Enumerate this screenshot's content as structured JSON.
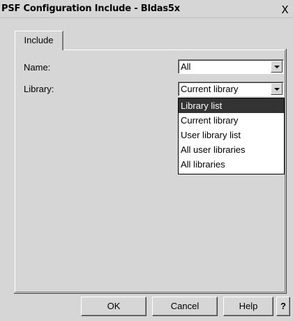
{
  "window": {
    "title": "PSF Configuration Include - Bldas5x",
    "close_glyph": "X"
  },
  "tabs": [
    {
      "label": "Include",
      "selected": true
    }
  ],
  "form": {
    "name_label": "Name:",
    "name_value": "All",
    "library_label": "Library:",
    "library_value": "Current library"
  },
  "library_dropdown": {
    "open": true,
    "options": [
      "Library list",
      "Current library",
      "User library list",
      "All user libraries",
      "All libraries"
    ],
    "highlighted": "Library list"
  },
  "buttons": {
    "ok": "OK",
    "cancel": "Cancel",
    "help": "Help",
    "whats_this": "?"
  },
  "colors": {
    "face": "#d6d6d6",
    "highlight": "#333333"
  }
}
